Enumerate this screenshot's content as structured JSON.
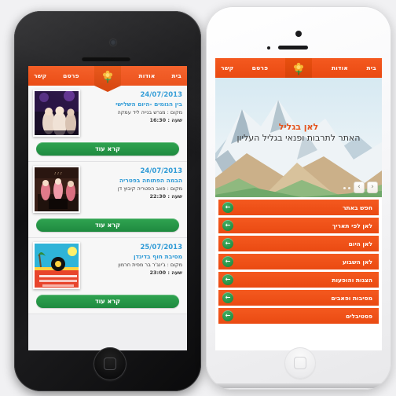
{
  "nav": {
    "items": [
      {
        "label": "בית",
        "name": "nav-home"
      },
      {
        "label": "אודות",
        "name": "nav-about"
      },
      {
        "label": "פרסם",
        "name": "nav-publish"
      },
      {
        "label": "קשר",
        "name": "nav-contact"
      }
    ],
    "logo_icon": "flower-icon"
  },
  "left_phone": {
    "device": "iphone-black",
    "events": [
      {
        "date": "24/07/2013",
        "title": "בין הגומים -היום השלישי",
        "place": "מקום : מגרש בנייה ליד עמקה",
        "time": "שעה : 16:30",
        "button": "קרא עוד",
        "thumb": "concert-crowd-photo"
      },
      {
        "date": "24/07/2013",
        "title": "הבמה הפתוחה בפטריה",
        "place": "מקום : פאב הפטריה קיבוץ דן",
        "time": "שעה : 22:30",
        "button": "קרא עוד",
        "thumb": "band-stage-photo"
      },
      {
        "date": "25/07/2013",
        "title": "מסיבת חוף בדיגדן",
        "place": "מקום : ג'ינג'ר בר מפית חרמון",
        "time": "שעה : 23:00",
        "button": "קרא עוד",
        "thumb": "beach-party-poster"
      }
    ]
  },
  "right_phone": {
    "device": "iphone-white",
    "hero": {
      "title": "לאן בגליל",
      "subtitle": "האתר לתרבות ופנאי בגליל העליון",
      "image": "snowy-mountain-illustration",
      "prev_label": "‹",
      "next_label": "›",
      "dots": 2
    },
    "menu": [
      {
        "label": "חפש באתר",
        "name": "menu-search-site"
      },
      {
        "label": "לאן לפי תאריך",
        "name": "menu-by-date"
      },
      {
        "label": "לאן היום",
        "name": "menu-today"
      },
      {
        "label": "לאן השבוע",
        "name": "menu-this-week"
      },
      {
        "label": "הצגות והופעות",
        "name": "menu-shows"
      },
      {
        "label": "מסיבות ופאבים",
        "name": "menu-parties-pubs"
      },
      {
        "label": "פסטיבלים",
        "name": "menu-festivals"
      }
    ]
  },
  "colors": {
    "orange": "#f4541d",
    "green": "#1f8a3f",
    "blue_text": "#2e9ad6",
    "page_bg": "#f1f1f3"
  }
}
